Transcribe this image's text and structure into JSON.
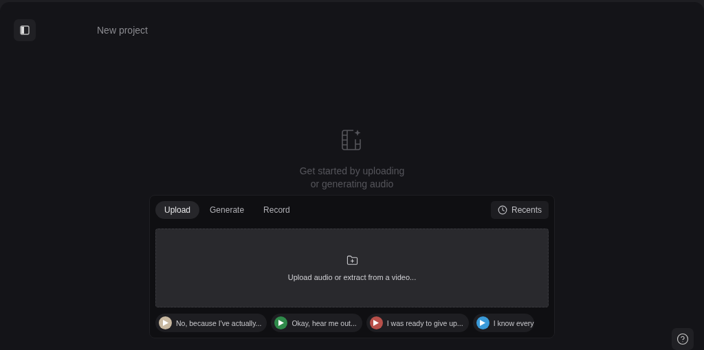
{
  "header": {
    "title": "New project"
  },
  "empty_state": {
    "message_lines": [
      "Get started by uploading",
      "or generating audio"
    ]
  },
  "composer": {
    "tabs": [
      {
        "label": "Upload",
        "selected": true
      },
      {
        "label": "Generate",
        "selected": false
      },
      {
        "label": "Record",
        "selected": false
      }
    ],
    "recents_button": "Recents",
    "dropzone": {
      "label": "Upload audio or extract from a video..."
    },
    "samples": [
      {
        "label": "No, because I've actually...",
        "color": "#c8b8a0"
      },
      {
        "label": "Okay, hear me out...",
        "color": "#2f8a4a"
      },
      {
        "label": "I was ready to give up...",
        "color": "#b8504a"
      },
      {
        "label": "I know every",
        "color": "#3a9ad8"
      }
    ]
  }
}
